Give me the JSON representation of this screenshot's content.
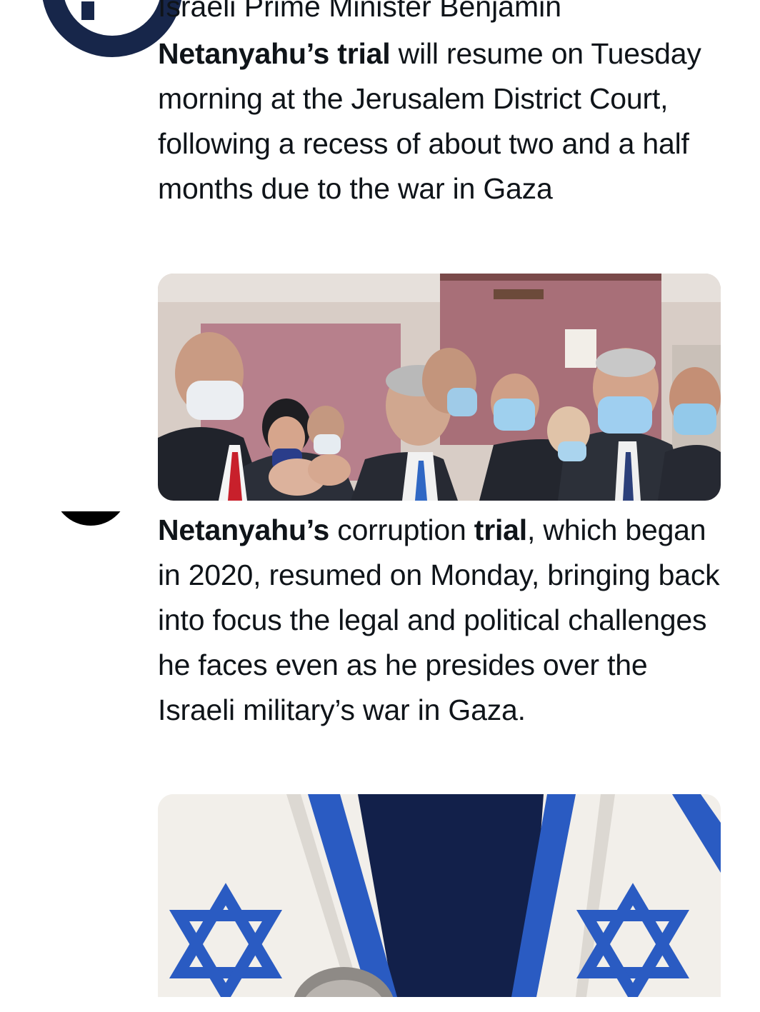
{
  "tweet_1": {
    "clipped_line": "Israeli Prime Minister Benjamin",
    "text_bold": "Netanyahu’s trial",
    "text_rest": " will resume on Tuesday morning at the Jerusalem District Court, following a recess of about two and a half months due to the war in Gaza",
    "image_icon": "photo-courtroom"
  },
  "tweet_2": {
    "text_bold_1": "Netanyahu’s",
    "text_mid": " corruption ",
    "text_bold_2": "trial",
    "text_rest": ", which began in 2020, resumed on Monday, bringing back into focus the legal and political challenges he faces even as he presides over the Israeli military’s war in Gaza.",
    "image_icon": "photo-israeli-flags"
  },
  "colors": {
    "text": "#0f1419",
    "avatar_navy": "#17264a",
    "flag_blue": "#2a5bc2"
  }
}
